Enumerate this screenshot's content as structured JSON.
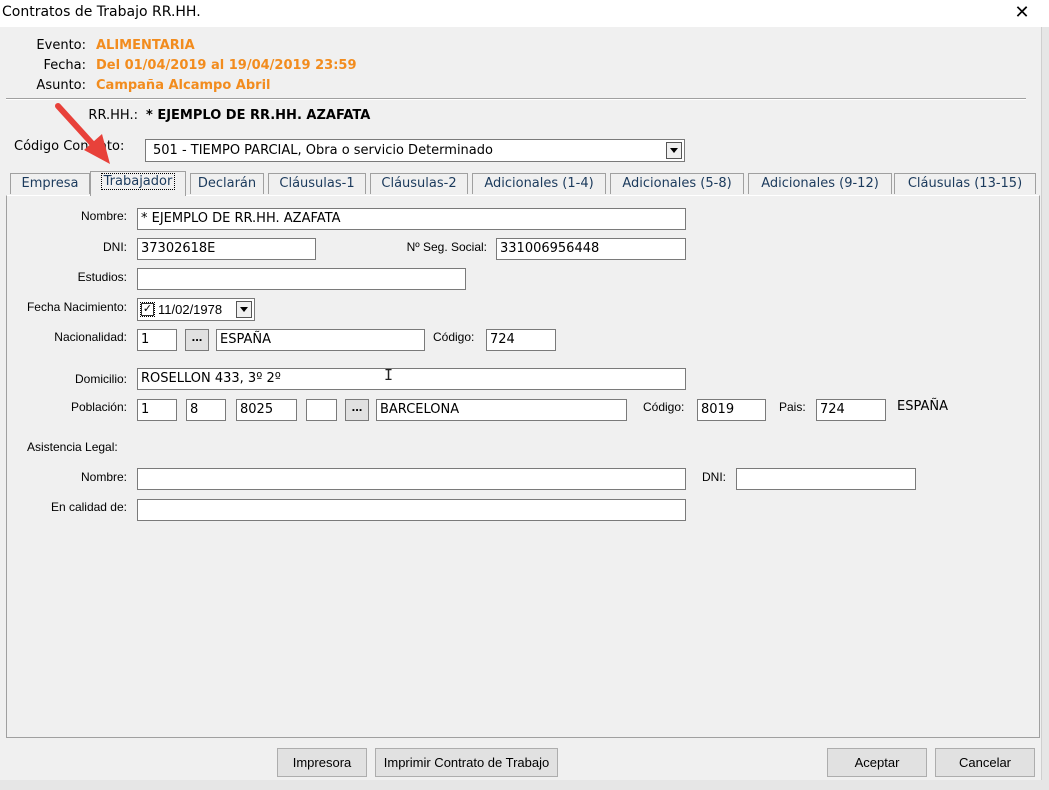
{
  "window": {
    "title": "Contratos de Trabajo RR.HH.",
    "close_glyph": "✕"
  },
  "header": {
    "evento_label": "Evento:",
    "evento_value": "ALIMENTARIA",
    "fecha_label": "Fecha:",
    "fecha_value": "Del 01/04/2019 al 19/04/2019 23:59",
    "asunto_label": "Asunto:",
    "asunto_value": "Campaña Alcampo Abril",
    "rrhh_label": "RR.HH.:",
    "rrhh_value": "* EJEMPLO DE RR.HH. AZAFATA",
    "accent_color": "#f28c1e"
  },
  "contract": {
    "label": "Código Contrato:",
    "value": "501 - TIEMPO PARCIAL, Obra o servicio Determinado"
  },
  "tabs": [
    {
      "label": "Empresa"
    },
    {
      "label": "Trabajador"
    },
    {
      "label": "Declarán"
    },
    {
      "label": "Cláusulas-1"
    },
    {
      "label": "Cláusulas-2"
    },
    {
      "label": "Adicionales (1-4)"
    },
    {
      "label": "Adicionales (5-8)"
    },
    {
      "label": "Adicionales (9-12)"
    },
    {
      "label": "Cláusulas (13-15)"
    }
  ],
  "active_tab": "Trabajador",
  "form": {
    "nombre_label": "Nombre:",
    "nombre": "* EJEMPLO DE RR.HH. AZAFATA",
    "dni_label": "DNI:",
    "dni": "37302618E",
    "seg_label": "Nº Seg. Social:",
    "seg": "331006956448",
    "estudios_label": "Estudios:",
    "estudios": "",
    "fecha_nac_label": "Fecha Nacimiento:",
    "fecha_nac": "11/02/1978",
    "fecha_nac_checked": "✓",
    "nacionalidad_label": "Nacionalidad:",
    "nac_code": "1",
    "nac_name": "ESPAÑA",
    "codigo_label": "Código:",
    "nac_codigo": "724",
    "domicilio_label": "Domicilio:",
    "domicilio": "ROSELLON 433, 3º 2º",
    "poblacion_label": "Población:",
    "pob_1": "1",
    "pob_2": "8",
    "pob_3": "8025",
    "pob_4": "",
    "pob_name": "BARCELONA",
    "pob_codigo_label": "Código:",
    "pob_codigo": "8019",
    "pais_label": "Pais:",
    "pais": "724",
    "pais_name": "ESPAÑA",
    "asistencia_label": "Asistencia Legal:",
    "al_nombre_label": "Nombre:",
    "al_nombre": "",
    "al_dni_label": "DNI:",
    "al_dni": "",
    "al_calidad_label": "En calidad de:",
    "al_calidad": "",
    "ellipsis": "..."
  },
  "buttons": {
    "impresora": "Impresora",
    "imprimir": "Imprimir Contrato de Trabajo",
    "aceptar": "Aceptar",
    "cancelar": "Cancelar"
  }
}
